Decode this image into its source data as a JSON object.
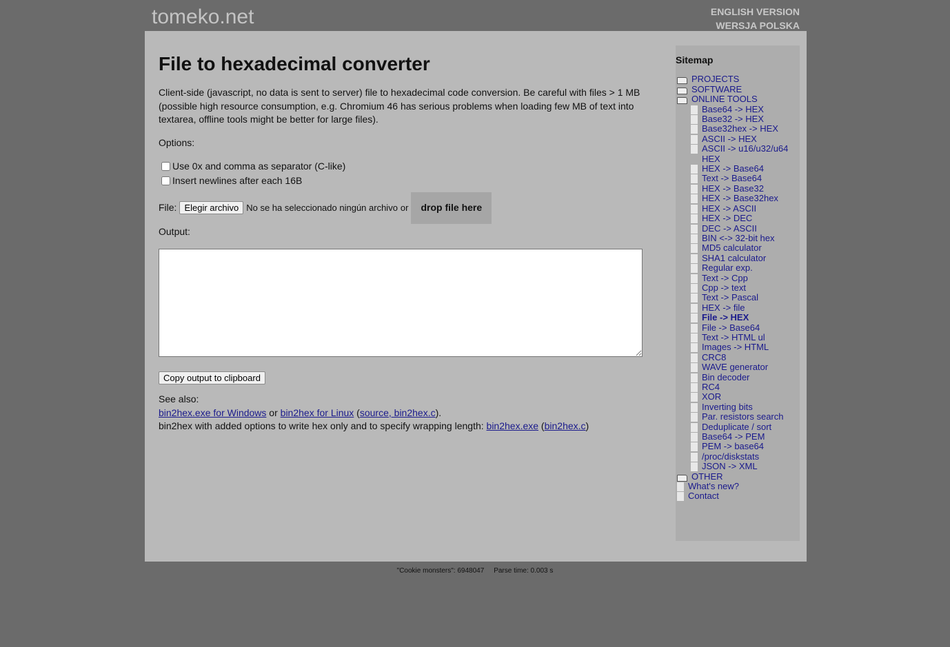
{
  "header": {
    "logo": "tomeko.net",
    "english": "ENGLISH VERSION",
    "polish": "WERSJA POLSKA"
  },
  "main": {
    "title": "File to hexadecimal converter",
    "intro": "Client-side (javascript, no data is sent to server) file to hexadecimal code conversion. Be careful with files > 1 MB (possible high resource consumption, e.g. Chromium 46 has serious problems when loading few MB of text into textarea, offline tools might be better for large files).",
    "options_label": "Options:",
    "opt1": "Use 0x and comma as separator (C-like)",
    "opt2": "Insert newlines after each 16B",
    "file_label": "File:",
    "choose_btn": "Elegir archivo",
    "no_file": "No se ha seleccionado ningún archivo",
    "or": "or",
    "drop": "drop file here",
    "output_label": "Output:",
    "output_value": "",
    "copy_btn": "Copy output to clipboard",
    "see_also": "See also:",
    "link_win": "bin2hex.exe for Windows",
    "sep_or": " or ",
    "link_linux": "bin2hex for Linux",
    "link_source": "source, bin2hex.c",
    "line2": "bin2hex with added options to write hex only and to specify wrapping length: ",
    "link_exe": "bin2hex.exe",
    "link_c": "bin2hex.c"
  },
  "sidebar": {
    "title": "Sitemap",
    "items": [
      {
        "label": "PROJECTS",
        "type": "folder"
      },
      {
        "label": "SOFTWARE",
        "type": "folder"
      },
      {
        "label": "ONLINE TOOLS",
        "type": "folder-open"
      },
      {
        "label": "Base64 -> HEX",
        "type": "sub"
      },
      {
        "label": "Base32 -> HEX",
        "type": "sub"
      },
      {
        "label": "Base32hex -> HEX",
        "type": "sub"
      },
      {
        "label": "ASCII -> HEX",
        "type": "sub"
      },
      {
        "label": "ASCII -> u16/u32/u64 HEX",
        "type": "sub"
      },
      {
        "label": "HEX -> Base64",
        "type": "sub"
      },
      {
        "label": "Text -> Base64",
        "type": "sub"
      },
      {
        "label": "HEX -> Base32",
        "type": "sub"
      },
      {
        "label": "HEX -> Base32hex",
        "type": "sub"
      },
      {
        "label": "HEX -> ASCII",
        "type": "sub"
      },
      {
        "label": "HEX -> DEC",
        "type": "sub"
      },
      {
        "label": "DEC -> ASCII",
        "type": "sub"
      },
      {
        "label": "BIN <-> 32-bit hex",
        "type": "sub"
      },
      {
        "label": "MD5 calculator",
        "type": "sub"
      },
      {
        "label": "SHA1 calculator",
        "type": "sub"
      },
      {
        "label": "Regular exp.",
        "type": "sub"
      },
      {
        "label": "Text -> Cpp",
        "type": "sub"
      },
      {
        "label": "Cpp -> text",
        "type": "sub"
      },
      {
        "label": "Text -> Pascal",
        "type": "sub"
      },
      {
        "label": "HEX -> file",
        "type": "sub"
      },
      {
        "label": "File -> HEX",
        "type": "sub",
        "current": true
      },
      {
        "label": "File -> Base64",
        "type": "sub"
      },
      {
        "label": "Text -> HTML ul",
        "type": "sub"
      },
      {
        "label": "Images -> HTML",
        "type": "sub"
      },
      {
        "label": "CRC8",
        "type": "sub"
      },
      {
        "label": "WAVE generator",
        "type": "sub"
      },
      {
        "label": "Bin decoder",
        "type": "sub"
      },
      {
        "label": "RC4",
        "type": "sub"
      },
      {
        "label": "XOR",
        "type": "sub"
      },
      {
        "label": "Inverting bits",
        "type": "sub"
      },
      {
        "label": "Par. resistors search",
        "type": "sub"
      },
      {
        "label": "Deduplicate / sort",
        "type": "sub"
      },
      {
        "label": "Base64 -> PEM",
        "type": "sub"
      },
      {
        "label": "PEM -> base64",
        "type": "sub"
      },
      {
        "label": "/proc/diskstats",
        "type": "sub"
      },
      {
        "label": "JSON -> XML",
        "type": "sub"
      },
      {
        "label": "OTHER",
        "type": "folder"
      },
      {
        "label": "What's new?",
        "type": "file"
      },
      {
        "label": "Contact",
        "type": "file"
      }
    ]
  },
  "footer": {
    "cookie": "\"Cookie monsters\": 6948047",
    "parse": "Parse time: 0.003 s"
  }
}
